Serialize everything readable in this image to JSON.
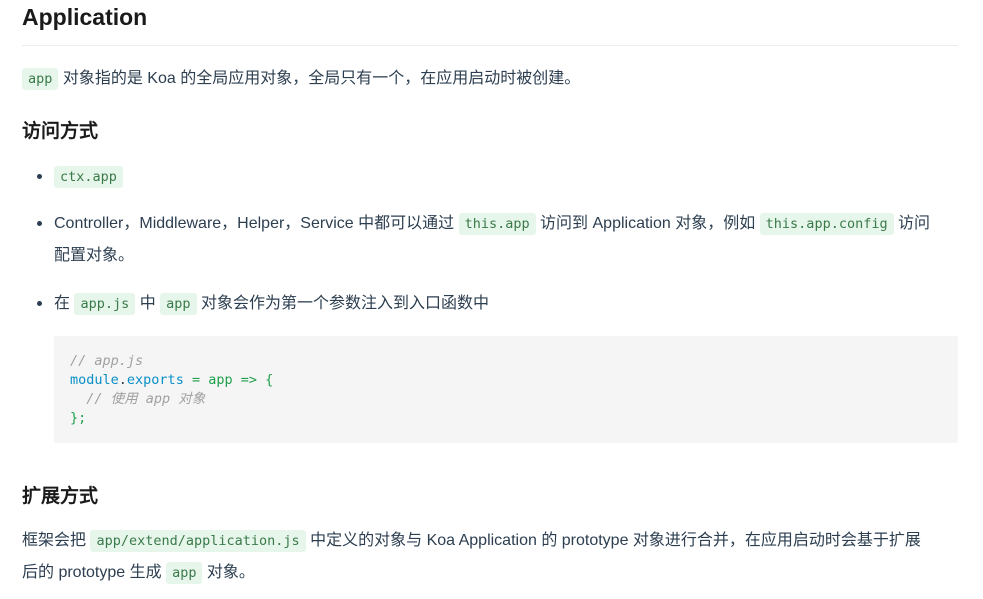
{
  "title": "Application",
  "intro": {
    "code": "app",
    "text": "对象指的是 Koa 的全局应用对象，全局只有一个，在应用启动时被创建。"
  },
  "section_access": {
    "heading": "访问方式",
    "item1": {
      "code": "ctx.app"
    },
    "item2": {
      "text1": "Controller，Middleware，Helper，Service 中都可以通过",
      "code1": "this.app",
      "text2": "访问到 Application 对象，例如",
      "code2": "this.app.config",
      "text3": "访问",
      "text4": "配置对象。"
    },
    "item3": {
      "text1": "在",
      "code1": "app.js",
      "text2": "中",
      "code2": "app",
      "text3": "对象会作为第一个参数注入到入口函数中"
    },
    "codeblock": {
      "line1": "// app.js",
      "line2_module": "module",
      "line2_dot": ".",
      "line2_exports": "exports",
      "line2_rest": " = app => {",
      "line3": "  // 使用 app 对象",
      "line4": "};"
    }
  },
  "section_extend": {
    "heading": "扩展方式",
    "text1": "框架会把",
    "code1": "app/extend/application.js",
    "text2": "中定义的对象与 Koa Application 的 prototype 对象进行合并，在应用启动时会基于扩展",
    "text3": "后的 prototype 生成",
    "code2": "app",
    "text4": "对象。"
  }
}
